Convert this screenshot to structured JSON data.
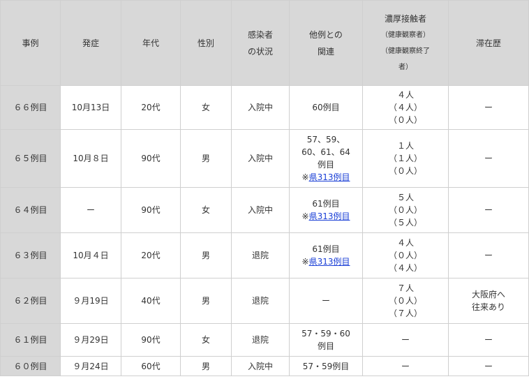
{
  "headers": {
    "case": "事例",
    "onset": "発症",
    "age": "年代",
    "sex": "性別",
    "status": [
      "感染者",
      "の状況"
    ],
    "relation": [
      "他例との",
      "関連"
    ],
    "contacts": {
      "title": "濃厚接触者",
      "sub1": "（健康観察者）",
      "sub2": "（健康観察終了",
      "sub3": "者）"
    },
    "stay": "滞在歴"
  },
  "rows": [
    {
      "case": "６６例目",
      "onset": "10月13日",
      "age": "20代",
      "sex": "女",
      "status": "入院中",
      "relation": [
        "60例目"
      ],
      "relation_link": null,
      "contacts": [
        "４人",
        "（４人）",
        "（０人）"
      ],
      "stay": [
        "ー"
      ]
    },
    {
      "case": "６５例目",
      "onset": "10月８日",
      "age": "90代",
      "sex": "男",
      "status": "入院中",
      "relation": [
        "57、59、",
        "60、61、64",
        "例目"
      ],
      "relation_link": "県313例目",
      "contacts": [
        "１人",
        "（１人）",
        "（０人）"
      ],
      "stay": [
        "ー"
      ]
    },
    {
      "case": "６４例目",
      "onset": "ー",
      "age": "90代",
      "sex": "女",
      "status": "入院中",
      "relation": [
        "61例目"
      ],
      "relation_link": "県313例目",
      "contacts": [
        "５人",
        "（０人）",
        "（５人）"
      ],
      "stay": [
        "ー"
      ]
    },
    {
      "case": "６３例目",
      "onset": "10月４日",
      "age": "20代",
      "sex": "男",
      "status": "退院",
      "relation": [
        "61例目"
      ],
      "relation_link": "県313例目",
      "contacts": [
        "４人",
        "（０人）",
        "（４人）"
      ],
      "stay": [
        "ー"
      ]
    },
    {
      "case": "６２例目",
      "onset": "９月19日",
      "age": "40代",
      "sex": "男",
      "status": "退院",
      "relation": [
        "ー"
      ],
      "relation_link": null,
      "contacts": [
        "７人",
        "（０人）",
        "（７人）"
      ],
      "stay": [
        "大阪府へ",
        "往来あり"
      ]
    },
    {
      "case": "６１例目",
      "onset": "９月29日",
      "age": "90代",
      "sex": "女",
      "status": "退院",
      "relation": [
        "57・59・60",
        "例目"
      ],
      "relation_link": null,
      "contacts": [
        "ー"
      ],
      "stay": [
        "ー"
      ]
    },
    {
      "case": "６０例目",
      "onset": "９月24日",
      "age": "60代",
      "sex": "男",
      "status": "入院中",
      "relation": [
        "57・59例目"
      ],
      "relation_link": null,
      "contacts": [
        "ー"
      ],
      "stay": [
        "ー"
      ]
    }
  ],
  "link_prefix": "※"
}
